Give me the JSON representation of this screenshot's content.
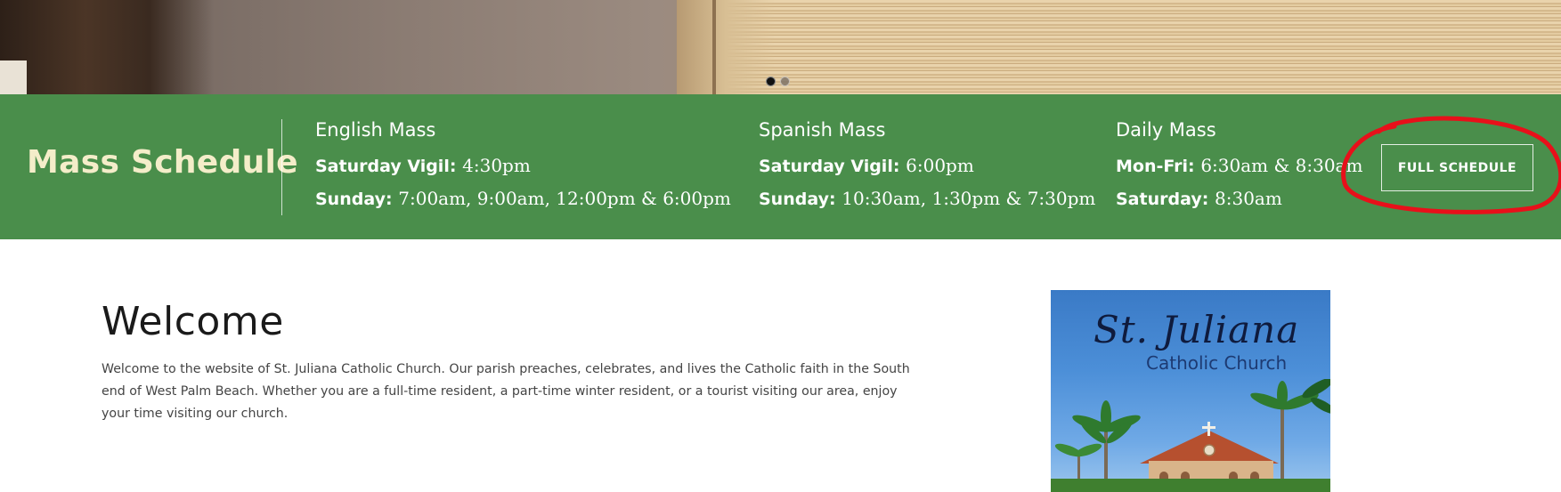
{
  "hero": {
    "slider_dots": [
      "slide-1",
      "slide-2"
    ],
    "active_dot": 0
  },
  "mass_schedule": {
    "title": "Mass Schedule",
    "columns": [
      {
        "heading": "English Mass",
        "lines": [
          {
            "label": "Saturday Vigil:",
            "time": "4:30pm"
          },
          {
            "label": "Sunday:",
            "time": "7:00am, 9:00am, 12:00pm & 6:00pm"
          }
        ]
      },
      {
        "heading": "Spanish Mass",
        "lines": [
          {
            "label": "Saturday Vigil:",
            "time": "6:00pm"
          },
          {
            "label": "Sunday:",
            "time": "10:30am, 1:30pm & 7:30pm"
          }
        ]
      },
      {
        "heading": "Daily Mass",
        "lines": [
          {
            "label": "Mon-Fri:",
            "time": "6:30am & 8:30am"
          },
          {
            "label": "Saturday:",
            "time": "8:30am"
          }
        ]
      }
    ],
    "button_label": "FULL SCHEDULE"
  },
  "welcome": {
    "title": "Welcome",
    "text": "Welcome to the website of St. Juliana Catholic Church. Our parish preaches, celebrates, and lives the Catholic faith in the South end of West Palm Beach. Whether you are a full-time resident, a part-time winter resident, or a tourist visiting our area, enjoy your time visiting our church."
  },
  "church_image": {
    "name": "St. Juliana",
    "subtitle": "Catholic Church"
  },
  "colors": {
    "schedule_bar": "#4a8e4b",
    "schedule_title": "#f4edc9",
    "annotation_circle": "#e8101a"
  }
}
